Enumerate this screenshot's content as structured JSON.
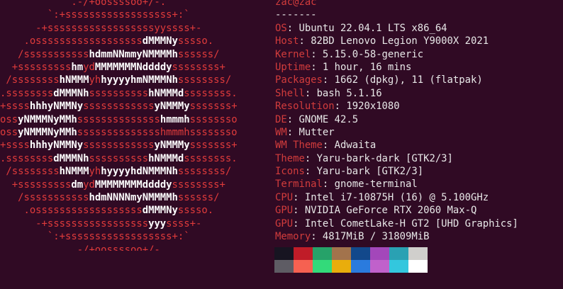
{
  "terminal": {
    "logo_lines": [
      [
        {
          "t": "            .-/+oossssoo+/-.",
          "c": "r"
        }
      ],
      [
        {
          "t": "        `:+ssssssssssssssssss+:`",
          "c": "r"
        }
      ],
      [
        {
          "t": "      -+ssssssssssssssssssyyssss+-",
          "c": "r"
        }
      ],
      [
        {
          "t": "    .ossssssssssssssssss",
          "c": "r"
        },
        {
          "t": "dMMMNy",
          "c": "w"
        },
        {
          "t": "sssso.",
          "c": "r"
        }
      ],
      [
        {
          "t": "   /sssssssssss",
          "c": "r"
        },
        {
          "t": "hdmmNNmmyNMMMMh",
          "c": "w"
        },
        {
          "t": "ssssss/",
          "c": "r"
        }
      ],
      [
        {
          "t": "  +sssssssss",
          "c": "r"
        },
        {
          "t": "hm",
          "c": "w"
        },
        {
          "t": "yd",
          "c": "r"
        },
        {
          "t": "MMMMMMMNddddy",
          "c": "w"
        },
        {
          "t": "ssssssss+",
          "c": "r"
        }
      ],
      [
        {
          "t": " /ssssssss",
          "c": "r"
        },
        {
          "t": "hNMMM",
          "c": "w"
        },
        {
          "t": "yh",
          "c": "r"
        },
        {
          "t": "hyyyyhmNMMMNh",
          "c": "w"
        },
        {
          "t": "ssssssss/",
          "c": "r"
        }
      ],
      [
        {
          "t": ".ssssssss",
          "c": "r"
        },
        {
          "t": "dMMMNh",
          "c": "w"
        },
        {
          "t": "ssssssssss",
          "c": "r"
        },
        {
          "t": "hNMMMd",
          "c": "w"
        },
        {
          "t": "ssssssss.",
          "c": "r"
        }
      ],
      [
        {
          "t": "+ssss",
          "c": "r"
        },
        {
          "t": "hhhyNMMNy",
          "c": "w"
        },
        {
          "t": "ssssssssssss",
          "c": "r"
        },
        {
          "t": "yNMMMy",
          "c": "w"
        },
        {
          "t": "sssssss+",
          "c": "r"
        }
      ],
      [
        {
          "t": "oss",
          "c": "r"
        },
        {
          "t": "yNMMMNyMMh",
          "c": "w"
        },
        {
          "t": "ssssssssssssss",
          "c": "r"
        },
        {
          "t": "hmmmh",
          "c": "w"
        },
        {
          "t": "ssssssso",
          "c": "r"
        }
      ],
      [
        {
          "t": "oss",
          "c": "r"
        },
        {
          "t": "yNMMMNyMMh",
          "c": "w"
        },
        {
          "t": "sssssssssssssshmmmhssssssso",
          "c": "r"
        }
      ],
      [
        {
          "t": "+ssss",
          "c": "r"
        },
        {
          "t": "hhhyNMMNy",
          "c": "w"
        },
        {
          "t": "ssssssssssss",
          "c": "r"
        },
        {
          "t": "yNMMMy",
          "c": "w"
        },
        {
          "t": "sssssss+",
          "c": "r"
        }
      ],
      [
        {
          "t": ".ssssssss",
          "c": "r"
        },
        {
          "t": "dMMMNh",
          "c": "w"
        },
        {
          "t": "ssssssssss",
          "c": "r"
        },
        {
          "t": "hNMMMd",
          "c": "w"
        },
        {
          "t": "ssssssss.",
          "c": "r"
        }
      ],
      [
        {
          "t": " /ssssssss",
          "c": "r"
        },
        {
          "t": "hNMMM",
          "c": "w"
        },
        {
          "t": "yh",
          "c": "r"
        },
        {
          "t": "hyyyyhdNMMMNh",
          "c": "w"
        },
        {
          "t": "ssssssss/",
          "c": "r"
        }
      ],
      [
        {
          "t": "  +sssssssss",
          "c": "r"
        },
        {
          "t": "dm",
          "c": "w"
        },
        {
          "t": "yd",
          "c": "r"
        },
        {
          "t": "MMMMMMMMddddy",
          "c": "w"
        },
        {
          "t": "ssssssss+",
          "c": "r"
        }
      ],
      [
        {
          "t": "   /sssssssssss",
          "c": "r"
        },
        {
          "t": "hdmNNNNmyNMMMMh",
          "c": "w"
        },
        {
          "t": "ssssss/",
          "c": "r"
        }
      ],
      [
        {
          "t": "    .ossssssssssssssssss",
          "c": "r"
        },
        {
          "t": "dMMMNy",
          "c": "w"
        },
        {
          "t": "sssso.",
          "c": "r"
        }
      ],
      [
        {
          "t": "      -+sssssssssssssssss",
          "c": "r"
        },
        {
          "t": "yyy",
          "c": "w"
        },
        {
          "t": "ssss+-",
          "c": "r"
        }
      ],
      [
        {
          "t": "        `:+ssssssssssssssssss+:`",
          "c": "r"
        }
      ],
      [
        {
          "t": "            .-/+oossssoo+/-.",
          "c": "r"
        }
      ]
    ],
    "title": "zac@zac",
    "separator": "-------",
    "info": [
      {
        "key": "OS",
        "value": "Ubuntu 22.04.1 LTS x86_64"
      },
      {
        "key": "Host",
        "value": "82BD Lenovo Legion Y9000X 2021"
      },
      {
        "key": "Kernel",
        "value": "5.15.0-58-generic"
      },
      {
        "key": "Uptime",
        "value": "1 hour, 16 mins"
      },
      {
        "key": "Packages",
        "value": "1662 (dpkg), 11 (flatpak)"
      },
      {
        "key": "Shell",
        "value": "bash 5.1.16"
      },
      {
        "key": "Resolution",
        "value": "1920x1080"
      },
      {
        "key": "DE",
        "value": "GNOME 42.5"
      },
      {
        "key": "WM",
        "value": "Mutter"
      },
      {
        "key": "WM Theme",
        "value": "Adwaita"
      },
      {
        "key": "Theme",
        "value": "Yaru-bark-dark [GTK2/3]"
      },
      {
        "key": "Icons",
        "value": "Yaru-bark [GTK2/3]"
      },
      {
        "key": "Terminal",
        "value": "gnome-terminal"
      },
      {
        "key": "CPU",
        "value": "Intel i7-10875H (16) @ 5.100GHz"
      },
      {
        "key": "GPU",
        "value": "NVIDIA GeForce RTX 2060 Max-Q"
      },
      {
        "key": "GPU",
        "value": "Intel CometLake-H GT2 [UHD Graphics]"
      },
      {
        "key": "Memory",
        "value": "4817MiB / 31809MiB"
      }
    ],
    "palette": {
      "normal": [
        "#171421",
        "#c01c28",
        "#26a269",
        "#a2734c",
        "#12488b",
        "#a347ba",
        "#2aa1b3",
        "#d0cfcc"
      ],
      "bright": [
        "#5e5c64",
        "#f66151",
        "#33da7a",
        "#e9ad0c",
        "#2a7bde",
        "#c061cb",
        "#33c7de",
        "#ffffff"
      ]
    }
  }
}
